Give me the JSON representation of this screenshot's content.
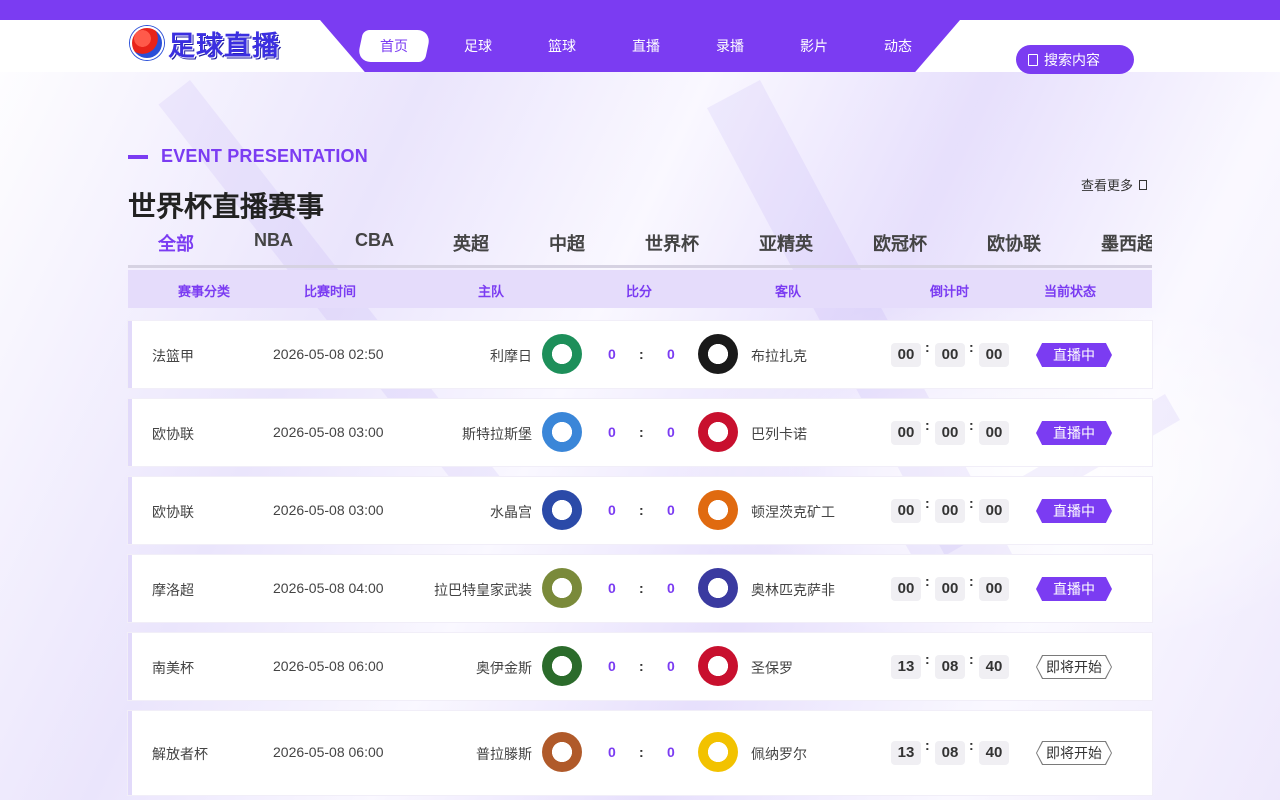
{
  "site": {
    "logo_text": "足球直播"
  },
  "nav": {
    "items": [
      {
        "label": "首页",
        "active": true
      },
      {
        "label": "足球"
      },
      {
        "label": "篮球"
      },
      {
        "label": "直播"
      },
      {
        "label": "录播"
      },
      {
        "label": "影片"
      },
      {
        "label": "动态"
      }
    ]
  },
  "search": {
    "label": "搜索内容",
    "icon": "search-icon"
  },
  "section": {
    "title_en": "EVENT PRESENTATION",
    "title_cn": "世界杯直播赛事",
    "more_label": "查看更多"
  },
  "tabs": [
    "全部",
    "NBA",
    "CBA",
    "英超",
    "中超",
    "世界杯",
    "亚精英",
    "欧冠杯",
    "欧协联",
    "墨西超"
  ],
  "table": {
    "headers": [
      "赛事分类",
      "比赛时间",
      "主队",
      "比分",
      "客队",
      "倒计时",
      "当前状态"
    ],
    "rows": [
      {
        "league": "法篮甲",
        "time": "2026-05-08 02:50",
        "home": "利摩日",
        "home_score": "0",
        "away_score": "0",
        "away": "布拉扎克",
        "cd": [
          "00",
          "00",
          "00"
        ],
        "status": "直播中",
        "live": true
      },
      {
        "league": "欧协联",
        "time": "2026-05-08 03:00",
        "home": "斯特拉斯堡",
        "home_score": "0",
        "away_score": "0",
        "away": "巴列卡诺",
        "cd": [
          "00",
          "00",
          "00"
        ],
        "status": "直播中",
        "live": true
      },
      {
        "league": "欧协联",
        "time": "2026-05-08 03:00",
        "home": "水晶宫",
        "home_score": "0",
        "away_score": "0",
        "away": "顿涅茨克矿工",
        "cd": [
          "00",
          "00",
          "00"
        ],
        "status": "直播中",
        "live": true
      },
      {
        "league": "摩洛超",
        "time": "2026-05-08 04:00",
        "home": "拉巴特皇家武装",
        "home_score": "0",
        "away_score": "0",
        "away": "奥林匹克萨非",
        "cd": [
          "00",
          "00",
          "00"
        ],
        "status": "直播中",
        "live": true
      },
      {
        "league": "南美杯",
        "time": "2026-05-08 06:00",
        "home": "奥伊金斯",
        "home_score": "0",
        "away_score": "0",
        "away": "圣保罗",
        "cd": [
          "13",
          "08",
          "40"
        ],
        "status": "即将开始",
        "live": false
      },
      {
        "league": "解放者杯",
        "time": "2026-05-08 06:00",
        "home": "普拉滕斯",
        "home_score": "0",
        "away_score": "0",
        "away": "佩纳罗尔",
        "cd": [
          "13",
          "08",
          "40"
        ],
        "status": "即将开始",
        "live": false
      }
    ]
  },
  "colors": {
    "accent": "#7b3cf2",
    "header_row": "#e5dcfb"
  }
}
